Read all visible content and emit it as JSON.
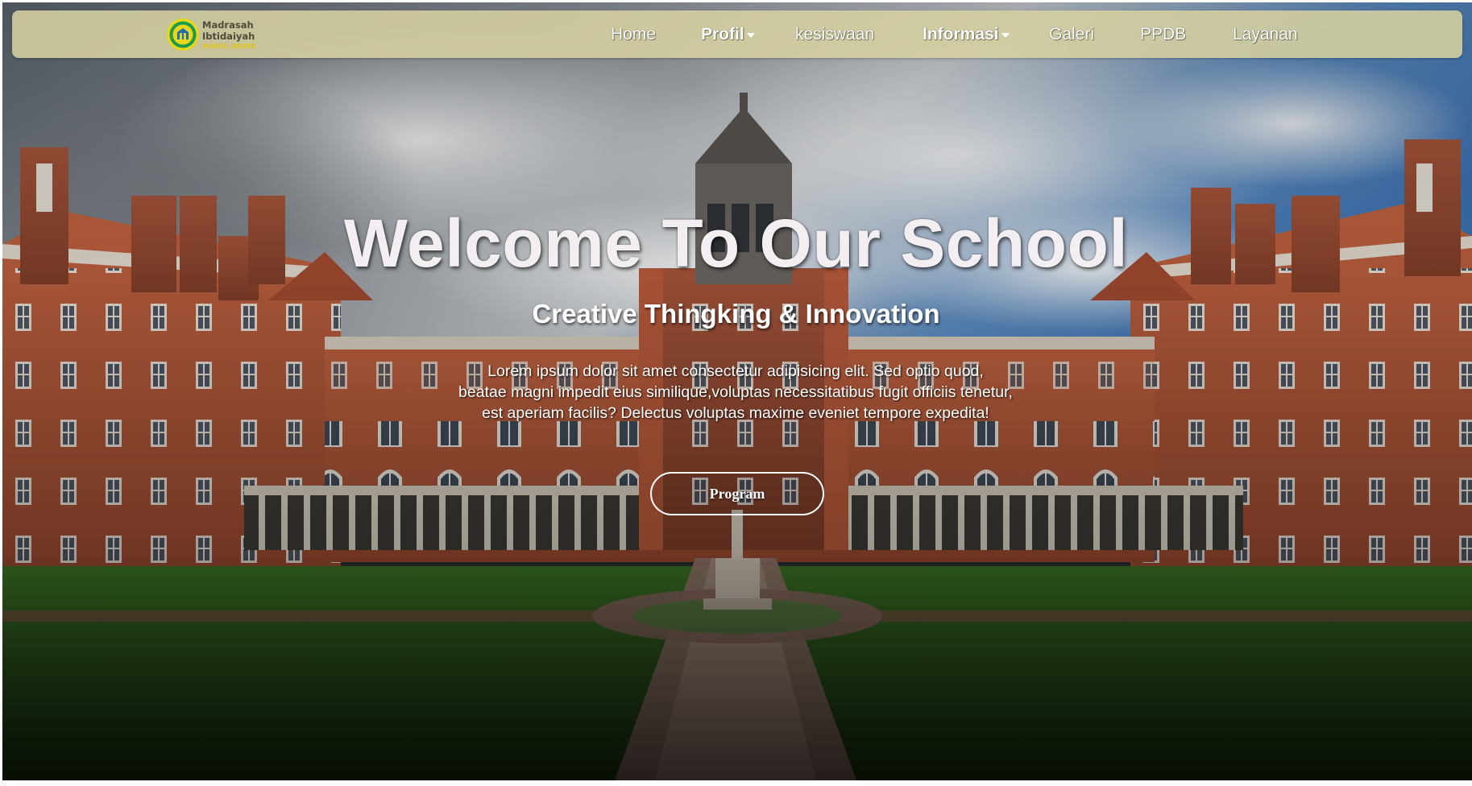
{
  "brand": {
    "line1": "Madrasah",
    "line2": "Ibtidaiyah",
    "line3": "NURUL QODIR"
  },
  "nav": {
    "items": [
      {
        "label": "Home",
        "dropdown": false
      },
      {
        "label": "Profil",
        "dropdown": true
      },
      {
        "label": "kesiswaan",
        "dropdown": false
      },
      {
        "label": "Informasi",
        "dropdown": true
      },
      {
        "label": "Galeri",
        "dropdown": false
      },
      {
        "label": "PPDB",
        "dropdown": false
      },
      {
        "label": "Layanan",
        "dropdown": false
      }
    ]
  },
  "hero": {
    "title": "Welcome To Our School",
    "subtitle": "Creative Thingking & Innovation",
    "description": [
      "Lorem ipsum dolor sit amet consectetur adipisicing elit. Sed optio quod,",
      "beatae magni impedit eius similique,voluptas necessitatibus fugit officiis tenetur,",
      "est aperiam facilis? Delectus voluptas maxime eveniet tempore expedita!"
    ],
    "button_label": "Program"
  },
  "colors": {
    "navbar_bg": "#d6d0a0",
    "nav_text": "#ffffff",
    "brand_text": "#4d4b3c",
    "brand_accent": "#e2c51a",
    "logo_green": "#1f9a4a",
    "logo_yellow": "#e6d61c",
    "building_brick": "#b5583a",
    "lawn": "#3c6b28",
    "sky": "#4a7fb8"
  },
  "icons": {
    "logo": "school-emblem-icon",
    "dropdown": "caret-down-icon"
  }
}
